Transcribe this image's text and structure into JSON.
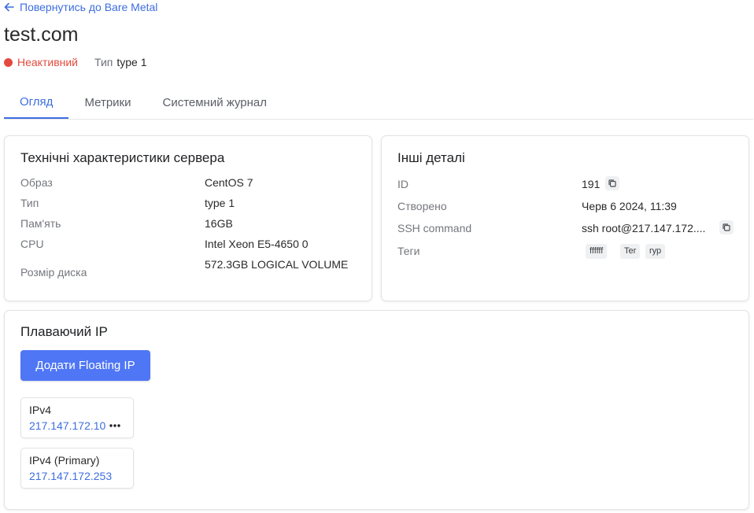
{
  "back_link": {
    "label": "Повернутись до Bare Metal"
  },
  "title": "test.com",
  "status": {
    "label": "Неактивний",
    "color": "#e34a3f"
  },
  "type_row": {
    "label": "Тип",
    "value": "type 1"
  },
  "tabs": [
    {
      "label": "Огляд",
      "active": true
    },
    {
      "label": "Метрики",
      "active": false
    },
    {
      "label": "Системний журнал",
      "active": false
    }
  ],
  "specs": {
    "title": "Технічні характеристики сервера",
    "rows": [
      {
        "label": "Образ",
        "value": "CentOS 7"
      },
      {
        "label": "Тип",
        "value": "type 1"
      },
      {
        "label": "Пам'ять",
        "value": "16GB"
      },
      {
        "label": "CPU",
        "value": "Intel Xeon E5-4650 0"
      },
      {
        "label": "Розмір диска",
        "value": "572.3GB LOGICAL VOLUME"
      }
    ]
  },
  "details": {
    "title": "Інші деталі",
    "id": {
      "label": "ID",
      "value": "191"
    },
    "created": {
      "label": "Створено",
      "value": "Черв 6 2024, 11:39"
    },
    "ssh": {
      "label": "SSH command",
      "value": "ssh root@217.147.172...."
    },
    "tags": {
      "label": "Теги",
      "items": [
        "ffffff",
        "Ter",
        "rур"
      ]
    }
  },
  "floating_ip": {
    "title": "Плаваючий IP",
    "add_button": "Додати Floating IP",
    "ips": [
      {
        "label": "IPv4",
        "address": "217.147.172.10"
      },
      {
        "label": "IPv4 (Primary)",
        "address": "217.147.172.253"
      }
    ]
  },
  "colors": {
    "accent": "#3d6ee0",
    "button": "#4f76f5"
  }
}
